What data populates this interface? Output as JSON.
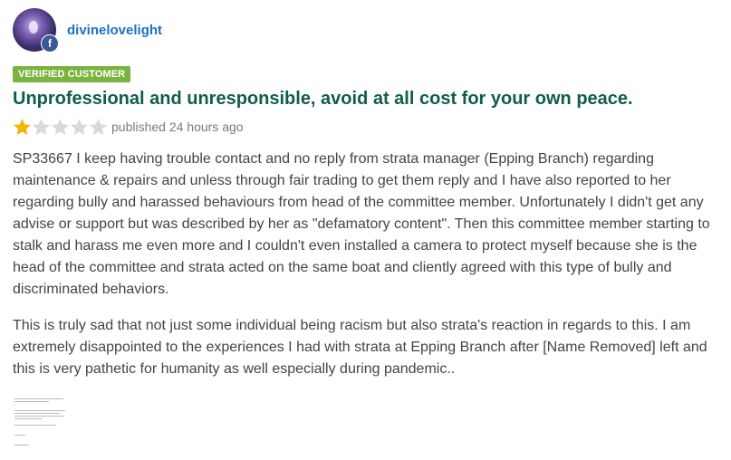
{
  "author": {
    "name": "divinelovelight",
    "avatar_icon": "user-avatar",
    "social_icon": "facebook-icon",
    "social_glyph": "f"
  },
  "badge": {
    "label": "VERIFIED CUSTOMER",
    "color": "#7ab33e"
  },
  "review": {
    "title": "Unprofessional and unresponsible, avoid at all cost for your own peace.",
    "rating": 1,
    "rating_max": 5,
    "published": "published 24 hours ago",
    "paragraphs": [
      "SP33667 I keep having trouble contact and no reply from strata manager (Epping Branch) regarding maintenance & repairs and unless through fair trading to get them reply and I have also reported to her regarding bully and harassed behaviours from head of the committee member. Unfortunately I didn't get any advise or support but was described by her as \"defamatory content\". Then this committee member starting to stalk and harass me even more and I couldn't even installed a camera to protect myself because she is the head of the committee and strata acted on the same boat and cliently agreed with this type of bully and discriminated behaviors.",
      "This is truly sad that not just some individual being racism but also strata's reaction in regards to this. I am extremely disappointed to the experiences I had with strata at Epping Branch after [Name Removed] left and this is very pathetic for humanity as well especially during pandemic.."
    ],
    "attachment_icon": "document-thumbnail"
  },
  "colors": {
    "author_link": "#1a73c7",
    "title": "#0f5e4c",
    "star_filled": "#f5b400",
    "star_empty": "#d9d9d9",
    "meta_text": "#7a7a7a",
    "body_text": "#444444"
  }
}
